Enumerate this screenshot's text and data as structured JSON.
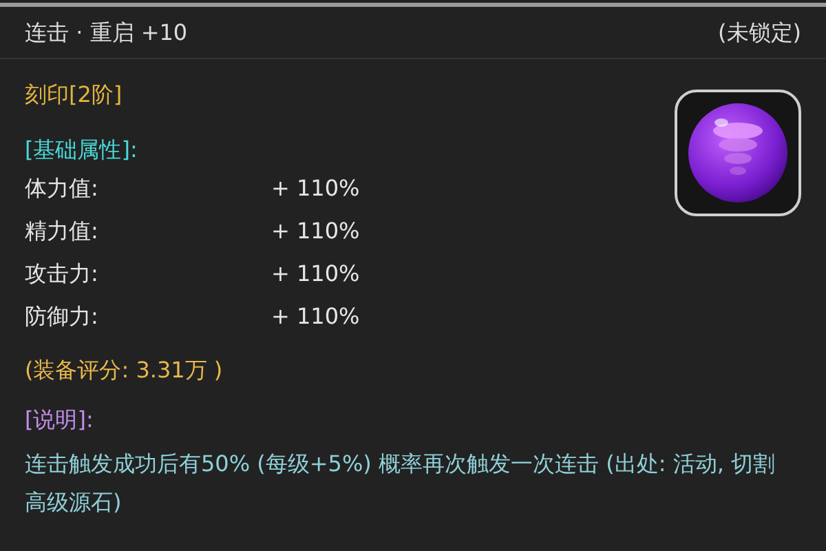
{
  "header": {
    "title": "连击 · 重启 +10",
    "lock_status": "(未锁定)"
  },
  "grade": "刻印[2阶]",
  "attributes_heading": "[基础属性]:",
  "attributes": [
    {
      "name": "体力值:",
      "value": "+ 110%"
    },
    {
      "name": "精力值:",
      "value": "+ 110%"
    },
    {
      "name": "攻击力:",
      "value": "+ 110%"
    },
    {
      "name": "防御力:",
      "value": "+ 110%"
    }
  ],
  "score": "(装备评分: 3.31万 )",
  "description_heading": "[说明]:",
  "description": "连击触发成功后有50% (每级+5%) 概率再次触发一次连击 (出处: 活动, 切割高级源石)"
}
